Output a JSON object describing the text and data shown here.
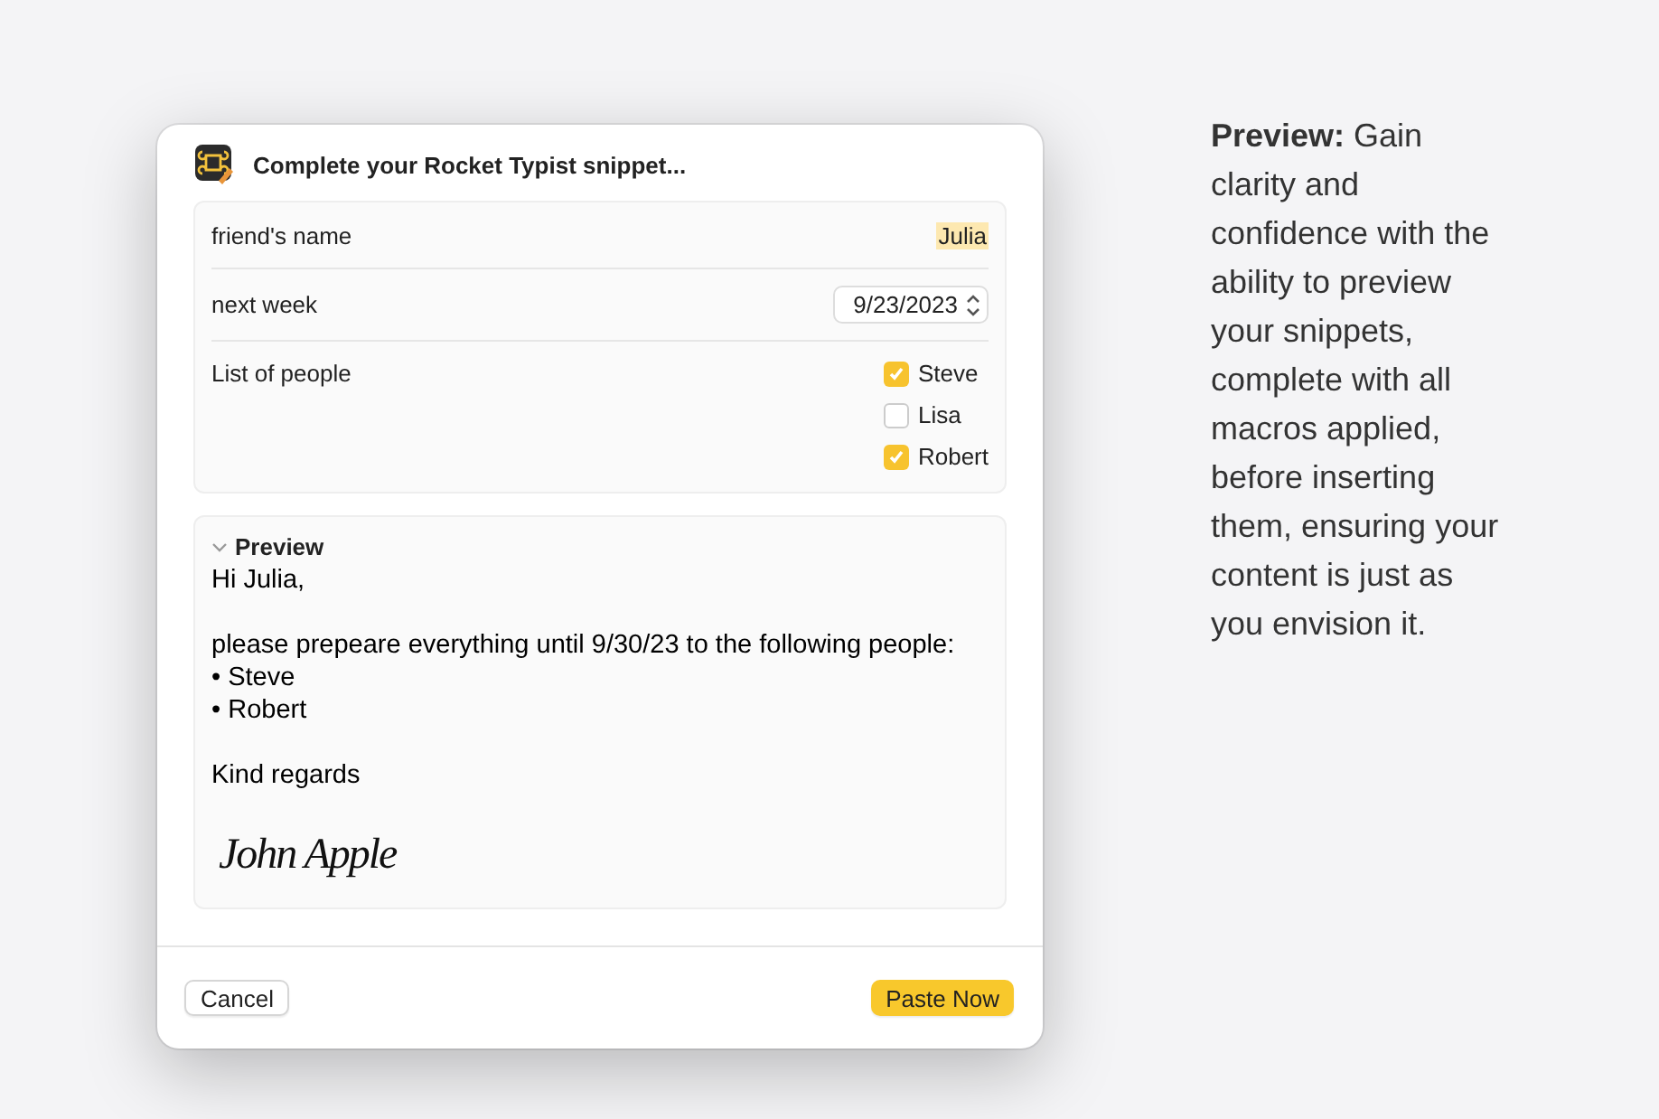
{
  "dialog": {
    "title": "Complete your Rocket Typist snippet...",
    "fields": [
      {
        "kind": "text",
        "label": "friend's name",
        "value": "Julia"
      },
      {
        "kind": "date",
        "label": "next week",
        "value": "9/23/2023"
      },
      {
        "kind": "checklist",
        "label": "List of people",
        "options": [
          {
            "label": "Steve",
            "checked": true
          },
          {
            "label": "Lisa",
            "checked": false
          },
          {
            "label": "Robert",
            "checked": true
          }
        ]
      }
    ],
    "preview": {
      "title": "Preview",
      "expanded": true,
      "paragraphs": [
        {
          "lines": [
            "Hi Julia,"
          ]
        },
        {
          "lines": [
            "please prepeare everything until 9/30/23 to the following people:",
            "• Steve",
            "• Robert"
          ]
        },
        {
          "lines": [
            "Kind regards"
          ]
        }
      ],
      "signature": "John Apple"
    },
    "buttons": [
      {
        "label": "Cancel",
        "kind": "secondary"
      },
      {
        "label": "Paste Now",
        "kind": "primary"
      }
    ]
  },
  "caption": "**Preview:** Gain clarity and confidence with the ability to preview your snippets, complete with all macros applied, before inserting them, ensuring your content is just as you envision it."
}
